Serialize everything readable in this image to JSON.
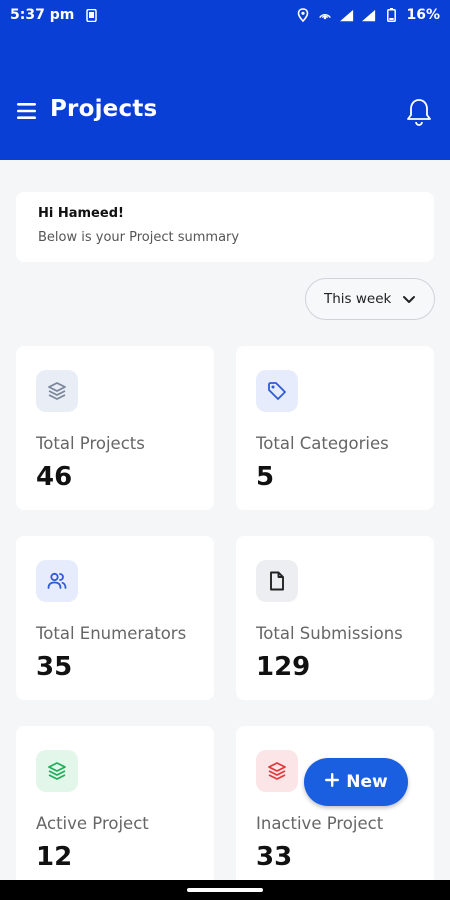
{
  "status_bar": {
    "time": "5:37 pm",
    "battery": "16%"
  },
  "header": {
    "title": "Projects"
  },
  "summary": {
    "greeting": "Hi Hameed!",
    "subtitle": "Below is your Project summary"
  },
  "filter": {
    "period": "This week"
  },
  "stats": [
    {
      "label": "Total Projects",
      "value": "46",
      "icon": "layers-icon",
      "color": "#7a869a",
      "bg": "#e9edf5"
    },
    {
      "label": "Total Categories",
      "value": "5",
      "icon": "tag-icon",
      "color": "#2f5bd8",
      "bg": "#e6ecfb"
    },
    {
      "label": "Total Enumerators",
      "value": "35",
      "icon": "users-icon",
      "color": "#2f5bd8",
      "bg": "#e6ecfb"
    },
    {
      "label": "Total Submissions",
      "value": "129",
      "icon": "file-icon",
      "color": "#333333",
      "bg": "#eceef1"
    },
    {
      "label": "Active Project",
      "value": "12",
      "icon": "layers-icon",
      "color": "#1fae5a",
      "bg": "#e3f6ea"
    },
    {
      "label": "Inactive Project",
      "value": "33",
      "icon": "layers-icon",
      "color": "#e0393e",
      "bg": "#fbe5e6"
    }
  ],
  "fab": {
    "label": "New"
  },
  "colors": {
    "brand": "#0a3fd6",
    "fab": "#1a5fe0"
  }
}
